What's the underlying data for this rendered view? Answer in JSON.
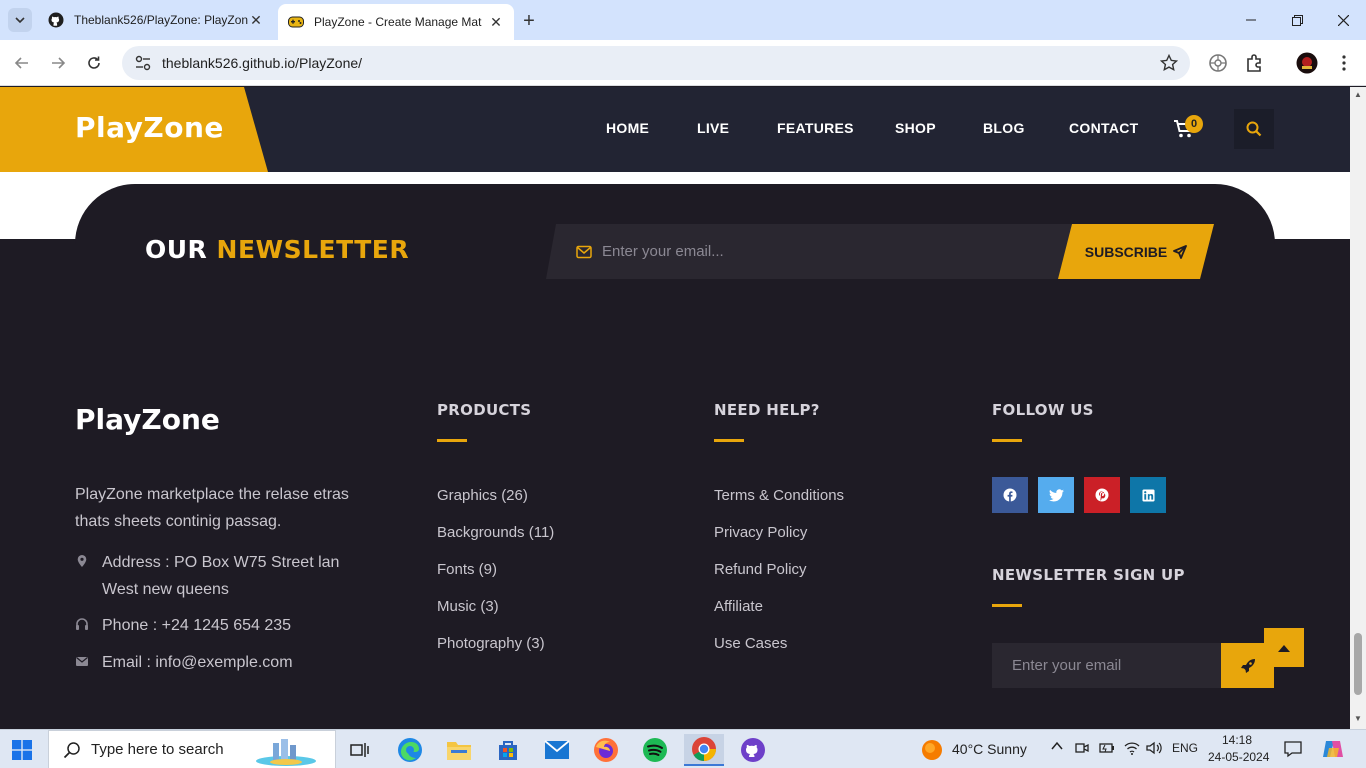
{
  "browser": {
    "tabs": [
      {
        "title": "Theblank526/PlayZone: PlayZon",
        "favicon": "github-icon",
        "active": false
      },
      {
        "title": "PlayZone - Create Manage Mat",
        "favicon": "gamepad-icon",
        "active": true
      }
    ],
    "url": "theblank526.github.io/PlayZone/"
  },
  "site": {
    "logo": "PlayZone",
    "nav": [
      "HOME",
      "LIVE",
      "FEATURES",
      "SHOP",
      "BLOG",
      "CONTACT"
    ],
    "cart_count": "0",
    "accent_color": "#e8a60c"
  },
  "newsletter": {
    "title_main": "OUR ",
    "title_accent": "NEWSLETTER",
    "placeholder": "Enter your email...",
    "button": "SUBSCRIBE"
  },
  "footer": {
    "logo": "PlayZone",
    "about": "PlayZone marketplace the relase etras thats sheets continig passag.",
    "address": "Address : PO Box W75 Street lan West new queens",
    "phone": "Phone : +24 1245 654 235",
    "email": "Email : info@exemple.com",
    "products_title": "PRODUCTS",
    "products": [
      "Graphics (26)",
      "Backgrounds (11)",
      "Fonts (9)",
      "Music (3)",
      "Photography (3)"
    ],
    "help_title": "NEED HELP?",
    "help": [
      "Terms & Conditions",
      "Privacy Policy",
      "Refund Policy",
      "Affiliate",
      "Use Cases"
    ],
    "follow_title": "FOLLOW US",
    "socials": [
      {
        "name": "facebook-icon",
        "color": "#3b5998"
      },
      {
        "name": "twitter-icon",
        "color": "#55acee"
      },
      {
        "name": "pinterest-icon",
        "color": "#cb2027"
      },
      {
        "name": "linkedin-icon",
        "color": "#0e76a8"
      }
    ],
    "signup_title": "NEWSLETTER SIGN UP",
    "signup_placeholder": "Enter your email"
  },
  "taskbar": {
    "search_placeholder": "Type here to search",
    "weather": "40°C  Sunny",
    "lang": "ENG",
    "time": "14:18",
    "date": "24-05-2024"
  }
}
